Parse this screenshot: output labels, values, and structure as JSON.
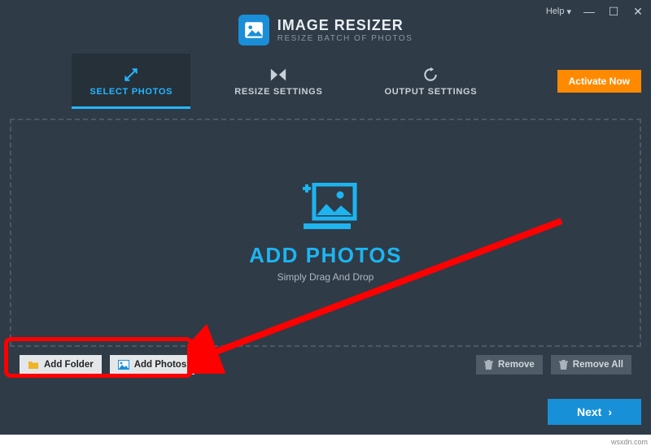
{
  "titlebar": {
    "help": "Help"
  },
  "brand": {
    "title": "IMAGE RESIZER",
    "subtitle": "RESIZE BATCH OF PHOTOS"
  },
  "tabs": {
    "select": "SELECT PHOTOS",
    "resize": "RESIZE SETTINGS",
    "output": "OUTPUT SETTINGS"
  },
  "activate": "Activate Now",
  "drop": {
    "title": "ADD PHOTOS",
    "subtitle": "Simply Drag And Drop"
  },
  "toolbar": {
    "addFolder": "Add Folder",
    "addPhotos": "Add Photos",
    "remove": "Remove",
    "removeAll": "Remove All"
  },
  "next": "Next",
  "watermark": "wsxdn.com"
}
